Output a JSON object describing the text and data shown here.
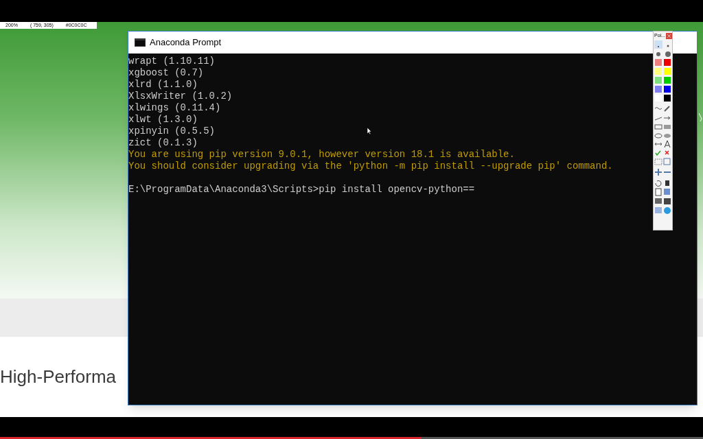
{
  "pixel_info": [
    "200%",
    "( 759, 305)",
    "#0C0C0C"
  ],
  "background_page": {
    "heading": "High-Performa"
  },
  "terminal_window": {
    "title": "Anaconda Prompt",
    "lines": [
      {
        "kind": "output",
        "text": "wrapt (1.10.11)"
      },
      {
        "kind": "output",
        "text": "xgboost (0.7)"
      },
      {
        "kind": "output",
        "text": "xlrd (1.1.0)"
      },
      {
        "kind": "output",
        "text": "XlsxWriter (1.0.2)"
      },
      {
        "kind": "output",
        "text": "xlwings (0.11.4)"
      },
      {
        "kind": "output",
        "text": "xlwt (1.3.0)"
      },
      {
        "kind": "output",
        "text": "xpinyin (0.5.5)"
      },
      {
        "kind": "output",
        "text": "zict (0.1.3)"
      },
      {
        "kind": "warning",
        "text": "You are using pip version 9.0.1, however version 18.1 is available."
      },
      {
        "kind": "warning",
        "text": "You should consider upgrading via the 'python -m pip install --upgrade pip' command."
      },
      {
        "kind": "blank"
      },
      {
        "kind": "output",
        "text": "E:\\ProgramData\\Anaconda3\\Scripts>pip install opencv-python=="
      }
    ]
  },
  "tool_palette": {
    "title": "Poi..."
  },
  "video_progress": {
    "level": 0.6
  }
}
